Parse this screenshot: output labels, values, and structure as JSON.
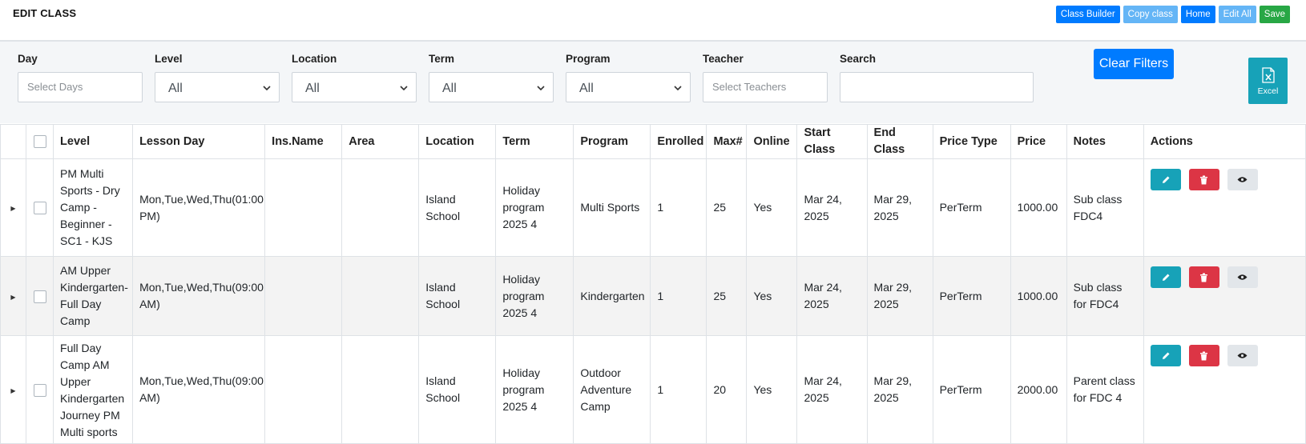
{
  "header": {
    "title": "EDIT CLASS",
    "buttons": {
      "class_builder": "Class Builder",
      "copy_class": "Copy class",
      "home": "Home",
      "edit_all": "Edit All",
      "save": "Save"
    }
  },
  "filters": {
    "day": {
      "label": "Day",
      "placeholder": "Select Days"
    },
    "level": {
      "label": "Level",
      "value": "All"
    },
    "location": {
      "label": "Location",
      "value": "All"
    },
    "term": {
      "label": "Term",
      "value": "All"
    },
    "program": {
      "label": "Program",
      "value": "All"
    },
    "teacher": {
      "label": "Teacher",
      "placeholder": "Select Teachers"
    },
    "search": {
      "label": "Search",
      "value": ""
    },
    "clear_label": "Clear Filters",
    "excel_label": "Excel"
  },
  "table": {
    "columns": [
      "Level",
      "Lesson Day",
      "Ins.Name",
      "Area",
      "Location",
      "Term",
      "Program",
      "Enrolled",
      "Max#",
      "Online",
      "Start Class",
      "End Class",
      "Price Type",
      "Price",
      "Notes",
      "Actions"
    ],
    "rows": [
      {
        "level": "PM Multi Sports - Dry Camp - Beginner - SC1 - KJS",
        "lesson_day": "Mon,Tue,Wed,Thu(01:00 PM)",
        "ins_name": "",
        "area": "",
        "location": "Island School",
        "term": "Holiday program 2025 4",
        "program": "Multi Sports",
        "enrolled": "1",
        "max": "25",
        "online": "Yes",
        "start": "Mar 24, 2025",
        "end": "Mar 29, 2025",
        "price_type": "PerTerm",
        "price": "1000.00",
        "notes": "Sub class FDC4"
      },
      {
        "level": "AM Upper Kindergarten-Full Day Camp",
        "lesson_day": "Mon,Tue,Wed,Thu(09:00 AM)",
        "ins_name": "",
        "area": "",
        "location": "Island School",
        "term": "Holiday program 2025 4",
        "program": "Kindergarten",
        "enrolled": "1",
        "max": "25",
        "online": "Yes",
        "start": "Mar 24, 2025",
        "end": "Mar 29, 2025",
        "price_type": "PerTerm",
        "price": "1000.00",
        "notes": "Sub class for FDC4"
      },
      {
        "level": "Full Day Camp AM Upper Kindergarten Journey PM Multi sports",
        "lesson_day": "Mon,Tue,Wed,Thu(09:00 AM)",
        "ins_name": "",
        "area": "",
        "location": "Island School",
        "term": "Holiday program 2025 4",
        "program": "Outdoor Adventure Camp",
        "enrolled": "1",
        "max": "20",
        "online": "Yes",
        "start": "Mar 24, 2025",
        "end": "Mar 29, 2025",
        "price_type": "PerTerm",
        "price": "2000.00",
        "notes": "Parent class for FDC 4"
      }
    ]
  },
  "colors": {
    "primary": "#007bff",
    "light_primary": "#64b5f6",
    "success": "#28a745",
    "info": "#17a2b8",
    "danger": "#dc3545"
  },
  "icons": [
    "expand-arrow-icon",
    "pencil-icon",
    "trash-icon",
    "eye-icon",
    "excel-icon",
    "chevron-down-icon"
  ]
}
